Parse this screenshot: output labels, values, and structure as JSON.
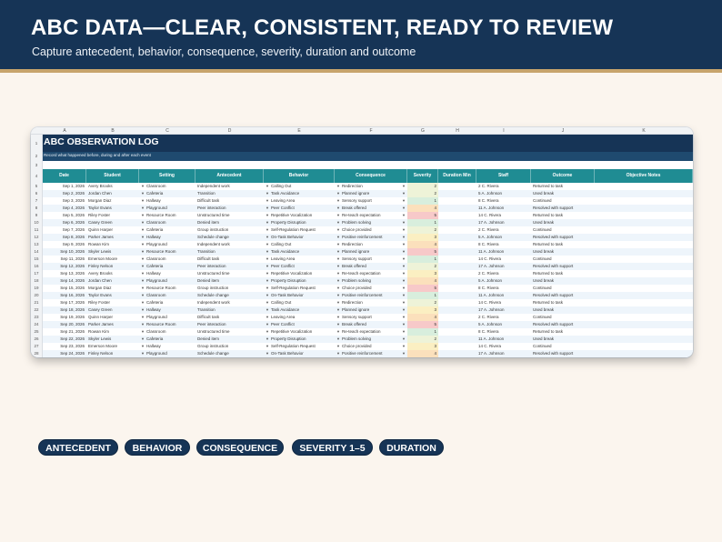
{
  "banner": {
    "headline": "ABC DATA—CLEAR, CONSISTENT, READY TO REVIEW",
    "subline": "Capture antecedent, behavior, consequence, severity, duration and outcome"
  },
  "sheet": {
    "column_letters": [
      "A",
      "B",
      "C",
      "D",
      "E",
      "F",
      "G",
      "H",
      "I",
      "J",
      "K"
    ],
    "row_numbers": [
      "1",
      "2",
      "3",
      "4",
      "5",
      "6",
      "7",
      "8",
      "9",
      "10",
      "11",
      "12",
      "13",
      "14",
      "15",
      "16",
      "17",
      "18",
      "19",
      "20",
      "21",
      "22",
      "23",
      "24",
      "25",
      "26",
      "27",
      "28"
    ],
    "title": "ABC OBSERVATION LOG",
    "subtitle": "Record what happened before, during and after each event",
    "headers": [
      "Date",
      "Student",
      "Setting",
      "Antecedent",
      "Behavior",
      "Consequence",
      "Severity",
      "Duration Min",
      "Staff",
      "Outcome",
      "Objective Notes"
    ],
    "severity_colors": {
      "1": "#d8eedd",
      "2": "#eef3d8",
      "3": "#fbefc2",
      "4": "#fbe0bc",
      "5": "#f7c9c9"
    },
    "rows": [
      {
        "date": "Sep 1, 2026",
        "student": "Avery Brooks",
        "setting": "Classroom",
        "antecedent": "Independent work",
        "behavior": "Calling Out",
        "consequence": "Redirection",
        "severity": "2",
        "duration": "",
        "staff": "2 C. Rivera",
        "outcome": "Returned to task"
      },
      {
        "date": "Sep 2, 2026",
        "student": "Jordan Chen",
        "setting": "Cafeteria",
        "antecedent": "Transition",
        "behavior": "Task Avoidance",
        "consequence": "Planned ignore",
        "severity": "2",
        "duration": "",
        "staff": "5 A. Johnson",
        "outcome": "Used break"
      },
      {
        "date": "Sep 3, 2026",
        "student": "Morgan Diaz",
        "setting": "Hallway",
        "antecedent": "Difficult task",
        "behavior": "Leaving Area",
        "consequence": "Sensory support",
        "severity": "1",
        "duration": "",
        "staff": "8 C. Rivera",
        "outcome": "Continued"
      },
      {
        "date": "Sep 4, 2026",
        "student": "Taylor Evans",
        "setting": "Playground",
        "antecedent": "Peer interaction",
        "behavior": "Peer Conflict",
        "consequence": "Break offered",
        "severity": "4",
        "duration": "",
        "staff": "11 A. Johnson",
        "outcome": "Resolved with support"
      },
      {
        "date": "Sep 5, 2026",
        "student": "Riley Foster",
        "setting": "Resource Room",
        "antecedent": "Unstructured time",
        "behavior": "Repetitive Vocalization",
        "consequence": "Re-teach expectation",
        "severity": "5",
        "duration": "",
        "staff": "14 C. Rivera",
        "outcome": "Returned to task"
      },
      {
        "date": "Sep 6, 2026",
        "student": "Casey Green",
        "setting": "Classroom",
        "antecedent": "Denied item",
        "behavior": "Property Disruption",
        "consequence": "Problem solving",
        "severity": "1",
        "duration": "",
        "staff": "17 A. Johnson",
        "outcome": "Used break"
      },
      {
        "date": "Sep 7, 2026",
        "student": "Quinn Harper",
        "setting": "Cafeteria",
        "antecedent": "Group instruction",
        "behavior": "Self-Regulation Request",
        "consequence": "Choice provided",
        "severity": "2",
        "duration": "",
        "staff": "2 C. Rivera",
        "outcome": "Continued"
      },
      {
        "date": "Sep 8, 2026",
        "student": "Parker James",
        "setting": "Hallway",
        "antecedent": "Schedule change",
        "behavior": "On-Task Behavior",
        "consequence": "Positive reinforcement",
        "severity": "3",
        "duration": "",
        "staff": "5 A. Johnson",
        "outcome": "Resolved with support"
      },
      {
        "date": "Sep 9, 2026",
        "student": "Rowan Kim",
        "setting": "Playground",
        "antecedent": "Independent work",
        "behavior": "Calling Out",
        "consequence": "Redirection",
        "severity": "4",
        "duration": "",
        "staff": "8 C. Rivera",
        "outcome": "Returned to task"
      },
      {
        "date": "Sep 10, 2026",
        "student": "Skyler Lewis",
        "setting": "Resource Room",
        "antecedent": "Transition",
        "behavior": "Task Avoidance",
        "consequence": "Planned ignore",
        "severity": "5",
        "duration": "",
        "staff": "11 A. Johnson",
        "outcome": "Used break"
      },
      {
        "date": "Sep 11, 2026",
        "student": "Emerson Moore",
        "setting": "Classroom",
        "antecedent": "Difficult task",
        "behavior": "Leaving Area",
        "consequence": "Sensory support",
        "severity": "1",
        "duration": "",
        "staff": "14 C. Rivera",
        "outcome": "Continued"
      },
      {
        "date": "Sep 12, 2026",
        "student": "Finley Nelson",
        "setting": "Cafeteria",
        "antecedent": "Peer interaction",
        "behavior": "Peer Conflict",
        "consequence": "Break offered",
        "severity": "2",
        "duration": "",
        "staff": "17 A. Johnson",
        "outcome": "Resolved with support"
      },
      {
        "date": "Sep 13, 2026",
        "student": "Avery Brooks",
        "setting": "Hallway",
        "antecedent": "Unstructured time",
        "behavior": "Repetitive Vocalization",
        "consequence": "Re-teach expectation",
        "severity": "3",
        "duration": "",
        "staff": "2 C. Rivera",
        "outcome": "Returned to task"
      },
      {
        "date": "Sep 14, 2026",
        "student": "Jordan Chen",
        "setting": "Playground",
        "antecedent": "Denied item",
        "behavior": "Property Disruption",
        "consequence": "Problem solving",
        "severity": "4",
        "duration": "",
        "staff": "5 A. Johnson",
        "outcome": "Used break"
      },
      {
        "date": "Sep 15, 2026",
        "student": "Morgan Diaz",
        "setting": "Resource Room",
        "antecedent": "Group instruction",
        "behavior": "Self-Regulation Request",
        "consequence": "Choice provided",
        "severity": "5",
        "duration": "",
        "staff": "8 C. Rivera",
        "outcome": "Continued"
      },
      {
        "date": "Sep 16, 2026",
        "student": "Taylor Evans",
        "setting": "Classroom",
        "antecedent": "Schedule change",
        "behavior": "On-Task Behavior",
        "consequence": "Positive reinforcement",
        "severity": "1",
        "duration": "",
        "staff": "11 A. Johnson",
        "outcome": "Resolved with support"
      },
      {
        "date": "Sep 17, 2026",
        "student": "Riley Foster",
        "setting": "Cafeteria",
        "antecedent": "Independent work",
        "behavior": "Calling Out",
        "consequence": "Redirection",
        "severity": "2",
        "duration": "",
        "staff": "14 C. Rivera",
        "outcome": "Returned to task"
      },
      {
        "date": "Sep 18, 2026",
        "student": "Casey Green",
        "setting": "Hallway",
        "antecedent": "Transition",
        "behavior": "Task Avoidance",
        "consequence": "Planned ignore",
        "severity": "3",
        "duration": "",
        "staff": "17 A. Johnson",
        "outcome": "Used break"
      },
      {
        "date": "Sep 19, 2026",
        "student": "Quinn Harper",
        "setting": "Playground",
        "antecedent": "Difficult task",
        "behavior": "Leaving Area",
        "consequence": "Sensory support",
        "severity": "4",
        "duration": "",
        "staff": "2 C. Rivera",
        "outcome": "Continued"
      },
      {
        "date": "Sep 20, 2026",
        "student": "Parker James",
        "setting": "Resource Room",
        "antecedent": "Peer interaction",
        "behavior": "Peer Conflict",
        "consequence": "Break offered",
        "severity": "5",
        "duration": "",
        "staff": "5 A. Johnson",
        "outcome": "Resolved with support"
      },
      {
        "date": "Sep 21, 2026",
        "student": "Rowan Kim",
        "setting": "Classroom",
        "antecedent": "Unstructured time",
        "behavior": "Repetitive Vocalization",
        "consequence": "Re-teach expectation",
        "severity": "1",
        "duration": "",
        "staff": "8 C. Rivera",
        "outcome": "Returned to task"
      },
      {
        "date": "Sep 22, 2026",
        "student": "Skyler Lewis",
        "setting": "Cafeteria",
        "antecedent": "Denied item",
        "behavior": "Property Disruption",
        "consequence": "Problem solving",
        "severity": "2",
        "duration": "",
        "staff": "11 A. Johnson",
        "outcome": "Used break"
      },
      {
        "date": "Sep 23, 2026",
        "student": "Emerson Moore",
        "setting": "Hallway",
        "antecedent": "Group instruction",
        "behavior": "Self-Regulation Request",
        "consequence": "Choice provided",
        "severity": "3",
        "duration": "",
        "staff": "14 C. Rivera",
        "outcome": "Continued"
      },
      {
        "date": "Sep 24, 2026",
        "student": "Finley Nelson",
        "setting": "Playground",
        "antecedent": "Schedule change",
        "behavior": "On-Task Behavior",
        "consequence": "Positive reinforcement",
        "severity": "4",
        "duration": "",
        "staff": "17 A. Johnson",
        "outcome": "Resolved with support"
      }
    ]
  },
  "chips": [
    "ANTECEDENT",
    "BEHAVIOR",
    "CONSEQUENCE",
    "SEVERITY 1–5",
    "DURATION"
  ],
  "colors": {
    "navy": "#163456",
    "teal_header": "#1f8c93",
    "gold_rule": "#c7a46c",
    "cream_bg": "#fbf5ee"
  }
}
